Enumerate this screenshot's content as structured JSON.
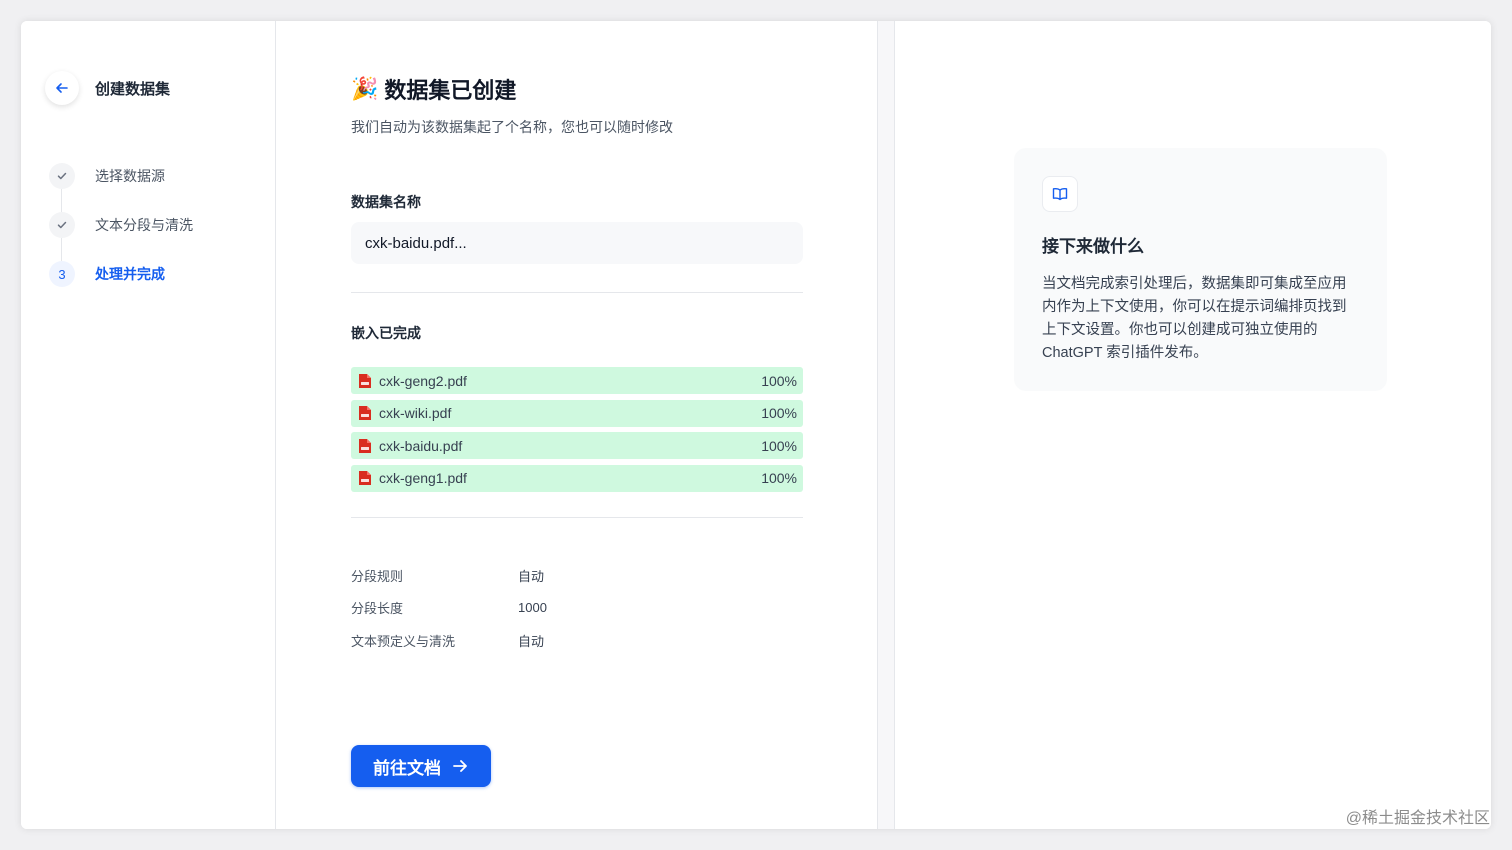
{
  "sidebar": {
    "title": "创建数据集",
    "steps": [
      {
        "label": "选择数据源",
        "state": "done"
      },
      {
        "label": "文本分段与清洗",
        "state": "done"
      },
      {
        "label": "处理并完成",
        "state": "active",
        "number": "3"
      }
    ]
  },
  "main": {
    "title_emoji": "🎉",
    "title": "数据集已创建",
    "subtitle": "我们自动为该数据集起了个名称，您也可以随时修改",
    "name_label": "数据集名称",
    "name_value": "cxk-baidu.pdf...",
    "embed_label": "嵌入已完成",
    "files": [
      {
        "name": "cxk-geng2.pdf",
        "progress": "100%"
      },
      {
        "name": "cxk-wiki.pdf",
        "progress": "100%"
      },
      {
        "name": "cxk-baidu.pdf",
        "progress": "100%"
      },
      {
        "name": "cxk-geng1.pdf",
        "progress": "100%"
      }
    ],
    "rules": [
      {
        "key": "分段规则",
        "value": "自动"
      },
      {
        "key": "分段长度",
        "value": "1000"
      },
      {
        "key": "文本预定义与清洗",
        "value": "自动"
      }
    ],
    "go_button": "前往文档"
  },
  "info_card": {
    "icon": "book-open-icon",
    "title": "接下来做什么",
    "body": "当文档完成索引处理后，数据集即可集成至应用内作为上下文使用，你可以在提示词编排页找到上下文设置。你也可以创建成可独立使用的 ChatGPT 索引插件发布。"
  },
  "watermark": "@稀土掘金技术社区",
  "colors": {
    "primary": "#155eef",
    "progress_fill": "#cff9df",
    "pdf_red": "#d92d20"
  }
}
